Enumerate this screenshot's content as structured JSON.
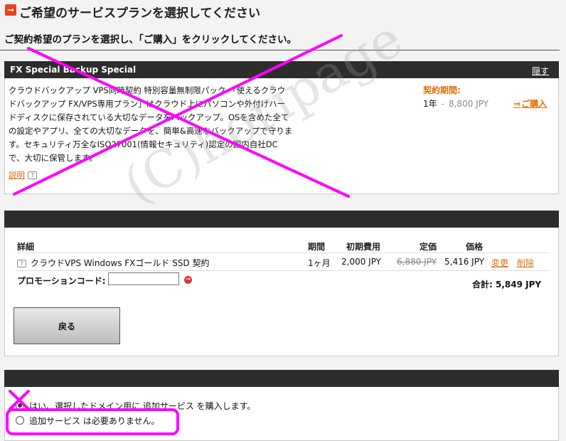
{
  "header": {
    "title": "ご希望のサービスプランを選択してください",
    "instruction": "ご契約希望のプランを選択し、「ご購入」をクリックしてください。"
  },
  "plan": {
    "name": "FX Special Backup Special",
    "hide_label": "隠す",
    "description": "クラウドバックアップ VPS同時契約 特別容量無制限パック 「使えるクラウドバックアップ FX/VPS専用プラン」はクラウド上にパソコンや外付けハードディスクに保存されている大切なデータをバックアップ。OSを含めた全ての設定やアプリ、全ての大切なデータを、簡単&高速なバックアップで守ります。セキュリティ万全なISO27001(情報セキュリティ)認定の国内自社DCで、大切に保管します。",
    "explain_label": "説明",
    "term_label": "契約期間:",
    "term": "1年",
    "term_sep": "-",
    "price": "8,800 JPY",
    "buy_label": "ご購入"
  },
  "cart": {
    "headers": {
      "detail": "詳細",
      "period": "期間",
      "initial_fee": "初期費用",
      "list_price": "定価",
      "price": "価格"
    },
    "rows": [
      {
        "name": "クラウドVPS Windows FXゴールド SSD 契約",
        "period": "1ヶ月",
        "initial_fee": "2,000 JPY",
        "list_price": "6,880 JPY",
        "price": "5,416 JPY",
        "change_label": "変更",
        "delete_label": "削除"
      }
    ],
    "promo_label": "プロモーションコード:",
    "promo_value": "",
    "total": "合計: 5,849 JPY",
    "back_label": "戻る"
  },
  "additional_service": {
    "options": [
      {
        "label": "はい、選択したドメイン用に 追加サービス を購入します。",
        "selected": true
      },
      {
        "label": "追加サービス は必要ありません。",
        "selected": false
      }
    ]
  },
  "watermark": "(C)horipage",
  "colors": {
    "accent": "#e36c09",
    "bar": "#2d2d2d",
    "annotation": "#ff00ff"
  }
}
